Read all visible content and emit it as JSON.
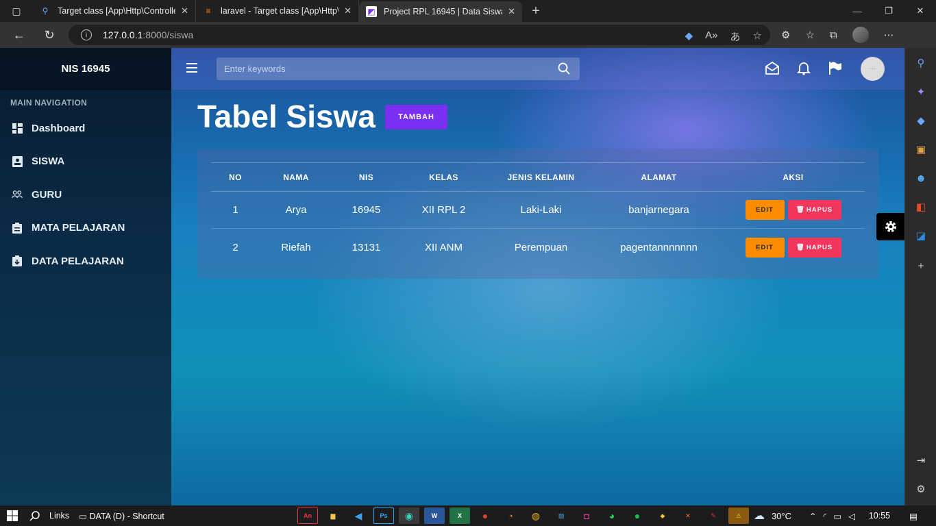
{
  "browser": {
    "tabs": [
      {
        "title": "Target class [App\\Http\\Controlle",
        "icon": "search-icon"
      },
      {
        "title": "laravel - Target class [App\\Http\\C",
        "icon": "stackoverflow-icon"
      },
      {
        "title": "Project RPL 16945 | Data Siswa",
        "icon": "page-icon",
        "active": true
      }
    ],
    "url_host": "127.0.0.1",
    "url_path": ":8000/siswa"
  },
  "sidebar": {
    "brand": "NIS 16945",
    "section": "MAIN NAVIGATION",
    "items": [
      {
        "label": "Dashboard",
        "icon": "dashboard-icon"
      },
      {
        "label": "SISWA",
        "icon": "contact-icon"
      },
      {
        "label": "GURU",
        "icon": "people-icon"
      },
      {
        "label": "MATA PELAJARAN",
        "icon": "clipboard-icon"
      },
      {
        "label": "DATA PELAJARAN",
        "icon": "clipboard-down-icon"
      }
    ]
  },
  "topnav": {
    "search_placeholder": "Enter keywords"
  },
  "page": {
    "title": "Tabel Siswa",
    "add_button": "TAMBAH"
  },
  "table": {
    "headers": [
      "NO",
      "NAMA",
      "NIS",
      "KELAS",
      "JENIS KELAMIN",
      "ALAMAT",
      "AKSI"
    ],
    "rows": [
      {
        "no": "1",
        "nama": "Arya",
        "nis": "16945",
        "kelas": "XII RPL 2",
        "jk": "Laki-Laki",
        "alamat": "banjarnegara",
        "edit": "EDIT",
        "hapus": "HAPUS"
      },
      {
        "no": "2",
        "nama": "Riefah",
        "nis": "13131",
        "kelas": "XII ANM",
        "jk": "Perempuan",
        "alamat": "pagentannnnnnn",
        "edit": "EDIT",
        "hapus": "HAPUS"
      }
    ]
  },
  "taskbar": {
    "links": "Links",
    "drive": "DATA (D) - Shortcut",
    "temperature": "30°C",
    "time": "10:55"
  },
  "colors": {
    "accent": "#7b2ff0",
    "edit": "#fb8c00",
    "delete": "#f5365c"
  }
}
